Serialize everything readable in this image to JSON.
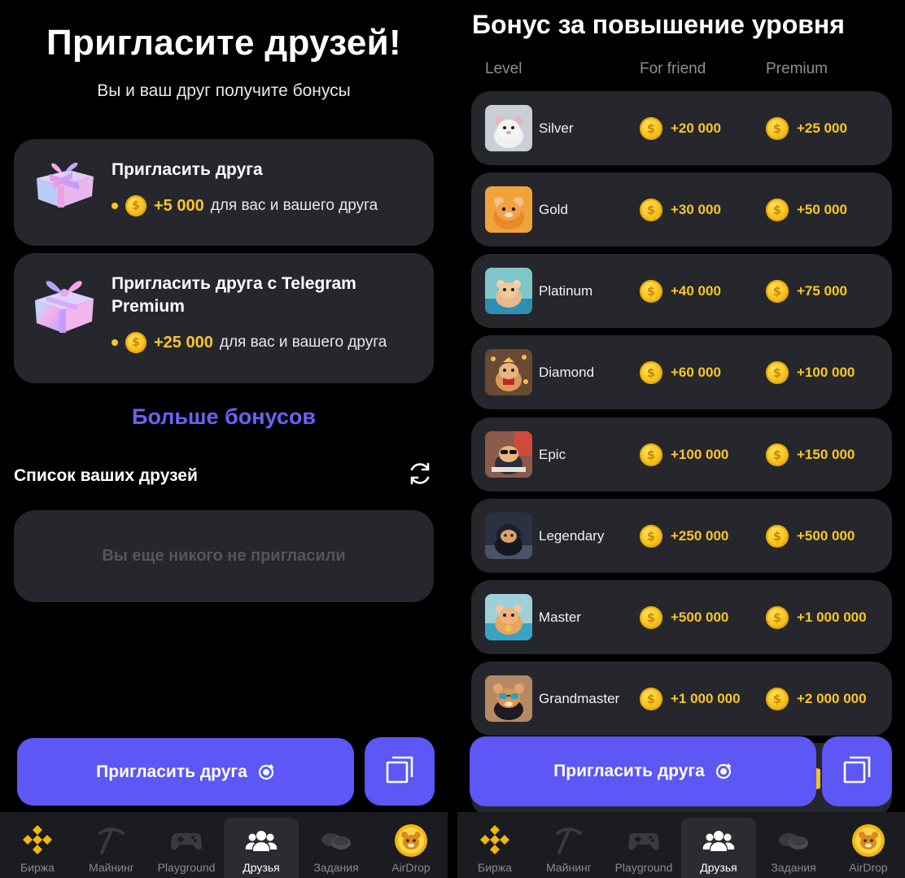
{
  "left_screen": {
    "title": "Пригласите друзей!",
    "subtitle": "Вы и ваш друг получите бонусы",
    "invite_cards": [
      {
        "title": "Пригласить друга",
        "amount": "+5 000",
        "text": "для вас и вашего друга",
        "icon": "gift-icon"
      },
      {
        "title": "Пригласить друга с Telegram Premium",
        "amount": "+25 000",
        "text": "для вас и вашего друга",
        "icon": "premium-gift-icon"
      }
    ],
    "more_bonuses": "Больше бонусов",
    "friends_list_title": "Список ваших друзей",
    "empty_text": "Вы еще никого не пригласили",
    "invite_button": "Пригласить друга"
  },
  "right_screen": {
    "title": "Бонус за повышение уровня",
    "columns": {
      "level": "Level",
      "friend": "For friend",
      "premium": "Premium"
    },
    "levels": [
      {
        "name": "Silver",
        "friend": "+20 000",
        "premium": "+25 000"
      },
      {
        "name": "Gold",
        "friend": "+30 000",
        "premium": "+50 000"
      },
      {
        "name": "Platinum",
        "friend": "+40 000",
        "premium": "+75 000"
      },
      {
        "name": "Diamond",
        "friend": "+60 000",
        "premium": "+100 000"
      },
      {
        "name": "Epic",
        "friend": "+100 000",
        "premium": "+150 000"
      },
      {
        "name": "Legendary",
        "friend": "+250 000",
        "premium": "+500 000"
      },
      {
        "name": "Master",
        "friend": "+500 000",
        "premium": "+1 000 000"
      },
      {
        "name": "Grandmaster",
        "friend": "+1 000 000",
        "premium": "+2 000 000"
      }
    ],
    "invite_button": "Пригласить друга"
  },
  "nav": {
    "items": [
      {
        "label": "Биржа",
        "icon": "exchange-icon"
      },
      {
        "label": "Майнинг",
        "icon": "pickaxe-icon"
      },
      {
        "label": "Playground",
        "icon": "gamepad-icon"
      },
      {
        "label": "Друзья",
        "icon": "friends-icon",
        "active": true
      },
      {
        "label": "Задания",
        "icon": "coins-icon"
      },
      {
        "label": "AirDrop",
        "icon": "hamster-coin-icon"
      }
    ]
  },
  "colors": {
    "background": "#000000",
    "card": "#26272c",
    "accent": "#5c57f5",
    "link": "#6b62f5",
    "gold": "#f8c62a",
    "nav_bg": "#1b1c20",
    "muted": "#8e8f95"
  }
}
